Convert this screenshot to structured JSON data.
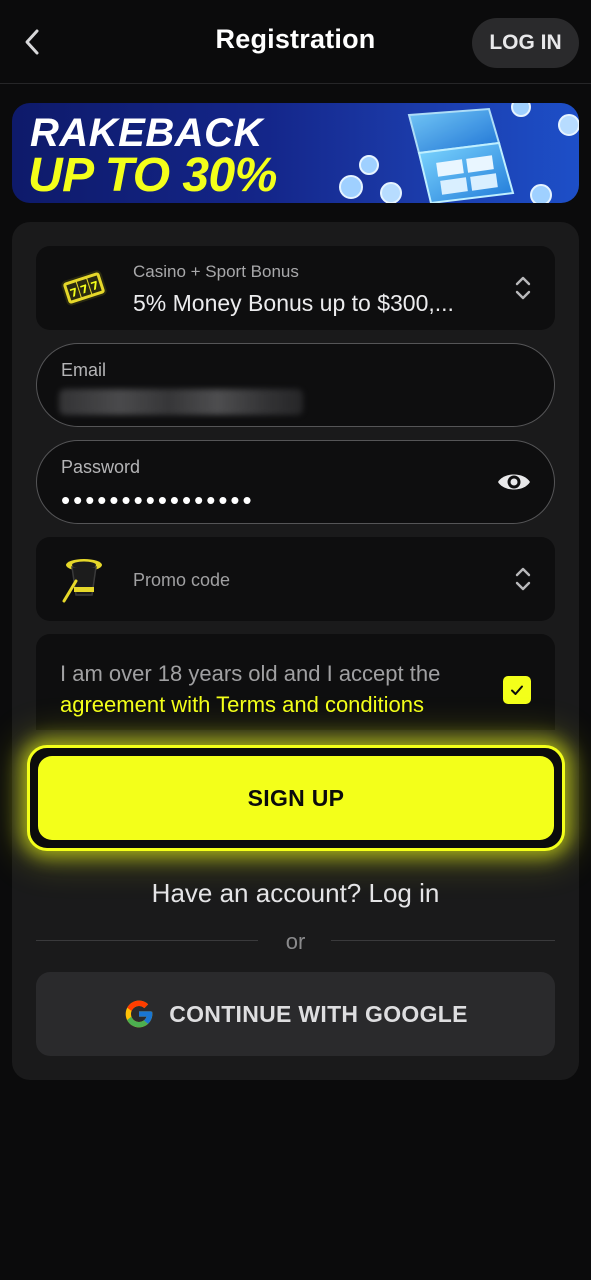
{
  "header": {
    "title": "Registration",
    "login_label": "LOG IN"
  },
  "banner": {
    "line1": "RAKEBACK",
    "line2": "UP TO 30%"
  },
  "bonus": {
    "label": "Casino + Sport Bonus",
    "value": "5% Money Bonus up to $300,..."
  },
  "email": {
    "label": "Email",
    "value": ""
  },
  "password": {
    "label": "Password",
    "value": "••••••••••••••••"
  },
  "promo": {
    "placeholder": "Promo code"
  },
  "terms": {
    "text": "I am over 18 years old and I accept the",
    "link": "agreement with Terms and conditions",
    "checked": true
  },
  "signup": {
    "label": "SIGN UP"
  },
  "account": {
    "text": "Have an account? Log in"
  },
  "divider": {
    "text": "or"
  },
  "google": {
    "label": "CONTINUE WITH GOOGLE"
  },
  "colors": {
    "accent": "#f3ff1a",
    "background": "#0b0b0c",
    "card": "#1a1a1b"
  }
}
